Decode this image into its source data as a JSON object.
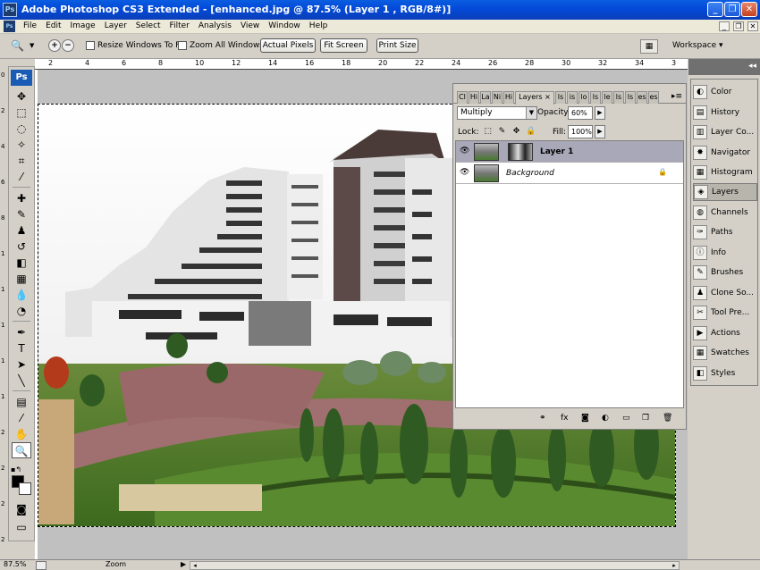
{
  "window": {
    "logo": "Ps",
    "title": "Adobe Photoshop CS3 Extended - [enhanced.jpg @ 87.5% (Layer 1 , RGB/8#)]",
    "buttons": [
      "_",
      "❐",
      "✕"
    ]
  },
  "menubar": {
    "doc_icon": "Ps",
    "items": [
      "File",
      "Edit",
      "Image",
      "Layer",
      "Select",
      "Filter",
      "Analysis",
      "View",
      "Window",
      "Help"
    ],
    "doc_buttons": [
      "_",
      "❐",
      "✕"
    ]
  },
  "options": {
    "zoom_in": "+",
    "zoom_out": "−",
    "resize_windows_label": "Resize Windows To Fit",
    "zoom_all_label": "Zoom All Windows",
    "actual_pixels": "Actual Pixels",
    "fit_screen": "Fit Screen",
    "print_size": "Print Size",
    "workspace": "Workspace ▾"
  },
  "toolbox": {
    "logo": "Ps"
  },
  "ruler": {
    "h_numbers": [
      "2",
      "4",
      "6",
      "8",
      "10",
      "12",
      "14",
      "16",
      "18",
      "20",
      "22",
      "24",
      "26",
      "28",
      "30",
      "32",
      "34",
      "3"
    ],
    "v_numbers": [
      "0",
      "2",
      "4",
      "6",
      "8",
      "1",
      "1",
      "1",
      "1",
      "1",
      "2",
      "2",
      "2",
      "2"
    ]
  },
  "layers_panel": {
    "tabs": [
      "Cl",
      "Hi",
      "La",
      "Ni",
      "Hi",
      "Layers",
      "ls",
      "is",
      "lo",
      "ls",
      "le",
      "ls",
      "ls",
      "es",
      "es"
    ],
    "active_tab": "Layers",
    "blend_mode": "Multiply",
    "opacity_label": "Opacity:",
    "opacity_value": "60%",
    "lock_label": "Lock:",
    "fill_label": "Fill:",
    "fill_value": "100%",
    "layers": [
      {
        "name": "Layer 1",
        "selected": true,
        "visible": true
      },
      {
        "name": "Background",
        "selected": false,
        "visible": true,
        "locked": true
      }
    ]
  },
  "dock": {
    "items": [
      "Color",
      "History",
      "Layer Co...",
      "Navigator",
      "Histogram",
      "Layers",
      "Channels",
      "Paths",
      "Info",
      "Brushes",
      "Clone So...",
      "Tool Pre...",
      "Actions",
      "Swatches",
      "Styles"
    ],
    "active": "Layers"
  },
  "status": {
    "zoom": "87.5%",
    "tool": "Zoom"
  }
}
